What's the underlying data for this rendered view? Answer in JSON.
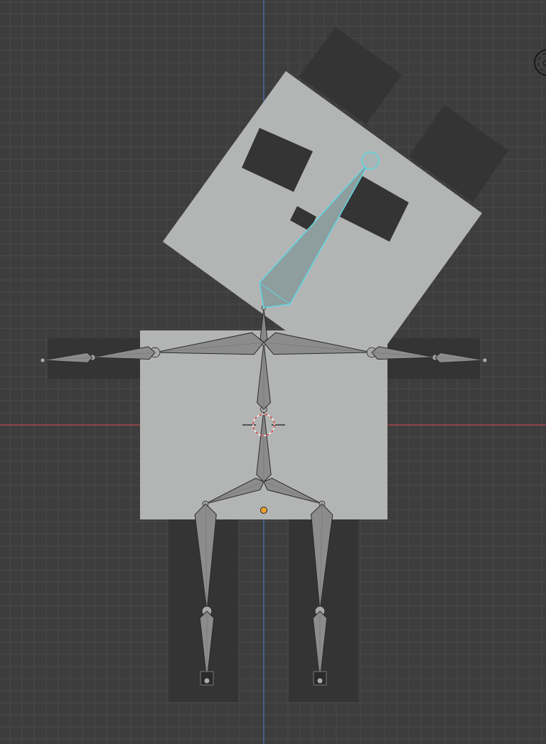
{
  "viewport": {
    "colors": {
      "background": "#3d3d3d",
      "grid_line": "#484848",
      "x_axis": "#b8474f",
      "y_axis": "#4a74b8",
      "mesh_light": "#b3b5b5",
      "mesh_dark": "#343434",
      "bone_fill": "#8c8c8c",
      "bone_outline": "#2a2a2a",
      "selected_bone_outline": "#5fd6e3",
      "selected_bone_fill": "#8e9d9d",
      "origin_dot": "#f0a030"
    },
    "icons": [
      "3d-cursor-icon",
      "navigation-gizmo-icon",
      "object-origin-icon"
    ]
  }
}
